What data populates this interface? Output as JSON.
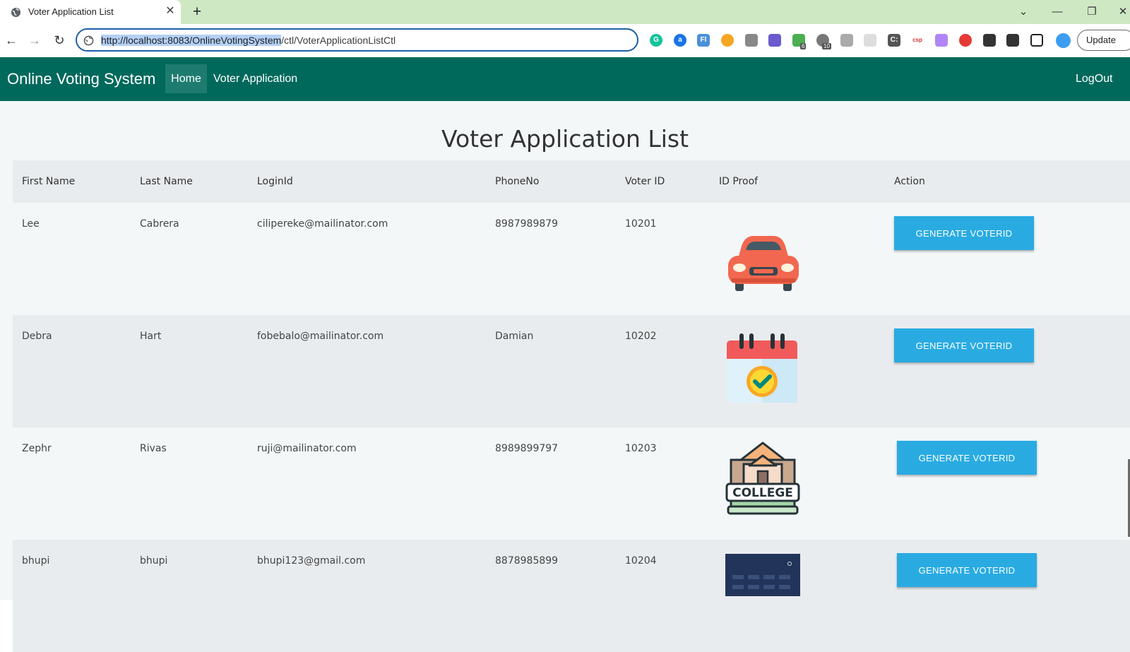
{
  "browser": {
    "tab_title": "Voter Application List",
    "url_selected": "http://localhost:8083/OnlineVotingSystem",
    "url_rest": "/ctl/VoterApplicationListCtl",
    "update_label": "Update",
    "ext_badges": [
      "6",
      "10"
    ],
    "ext_labels": [
      "G",
      "a",
      "Fl",
      "C:",
      "csp"
    ]
  },
  "app": {
    "brand": "Online Voting System",
    "nav": {
      "home": "Home",
      "voter_application": "Voter Application",
      "logout": "LogOut"
    },
    "page_title": "Voter Application List",
    "columns": [
      "First Name",
      "Last Name",
      "LoginId",
      "PhoneNo",
      "Voter ID",
      "ID Proof",
      "Action"
    ],
    "rows": [
      {
        "first_name": "Lee",
        "last_name": "Cabrera",
        "login_id": "cilipereke@mailinator.com",
        "phone": "8987989879",
        "voter_id": "10201",
        "proof": "car-icon",
        "action": "GENERATE VOTERID"
      },
      {
        "first_name": "Debra",
        "last_name": "Hart",
        "login_id": "fobebalo@mailinator.com",
        "phone": "Damian",
        "voter_id": "10202",
        "proof": "calendar-check-icon",
        "action": "GENERATE VOTERID"
      },
      {
        "first_name": "Zephr",
        "last_name": "Rivas",
        "login_id": "ruji@mailinator.com",
        "phone": "8989899797",
        "voter_id": "10203",
        "proof": "college-icon",
        "action": "GENERATE VOTERID"
      },
      {
        "first_name": "bhupi",
        "last_name": "bhupi",
        "login_id": "bhupi123@gmail.com",
        "phone": "8878985899",
        "voter_id": "10204",
        "proof": "calculator-icon",
        "action": "GENERATE VOTERID"
      }
    ],
    "college_label": "COLLEGE"
  },
  "colors": {
    "navbar": "#00695c",
    "button": "#29abe2",
    "tabstrip": "#cfe8c4"
  }
}
